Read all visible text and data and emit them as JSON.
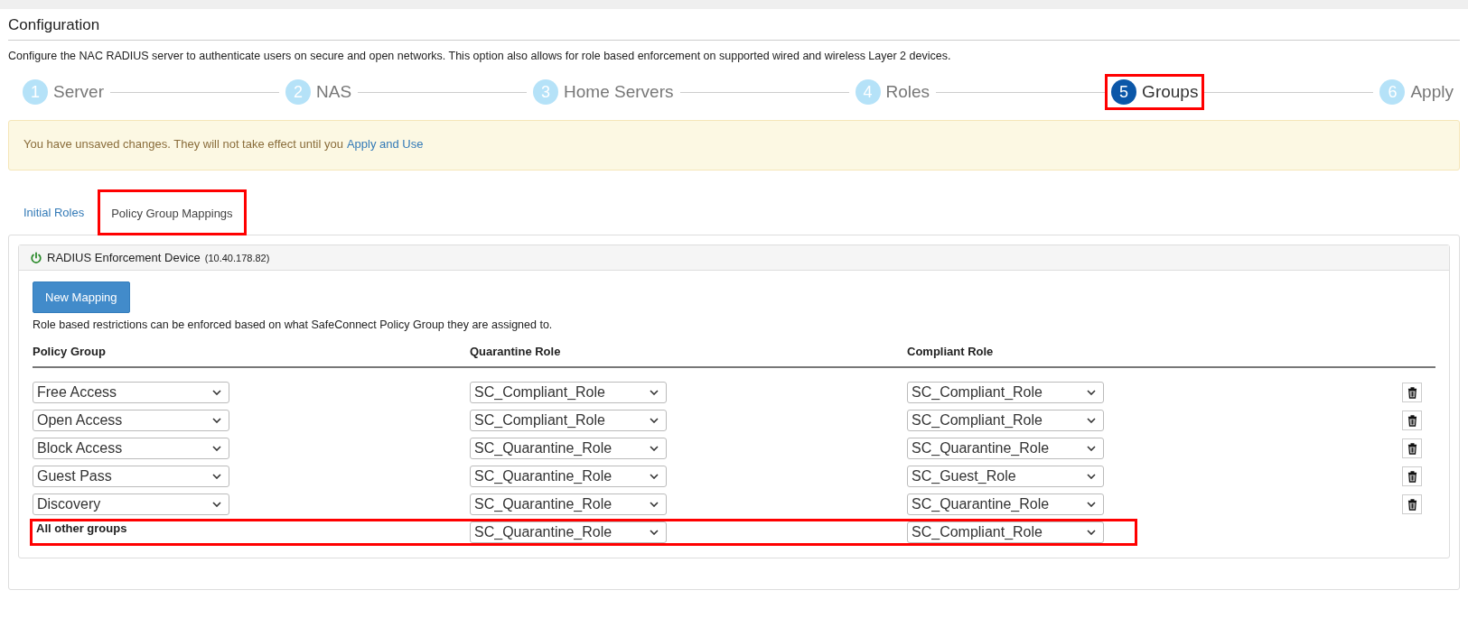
{
  "title": "Configuration",
  "description": "Configure the NAC RADIUS server to authenticate users on secure and open networks. This option also allows for role based enforcement on supported wired and wireless Layer 2 devices.",
  "steps": [
    {
      "number": "1",
      "label": "Server",
      "selected": false,
      "outlined": false
    },
    {
      "number": "2",
      "label": "NAS",
      "selected": false,
      "outlined": false
    },
    {
      "number": "3",
      "label": "Home Servers",
      "selected": false,
      "outlined": false
    },
    {
      "number": "4",
      "label": "Roles",
      "selected": false,
      "outlined": false
    },
    {
      "number": "5",
      "label": "Groups",
      "selected": true,
      "outlined": true
    },
    {
      "number": "6",
      "label": "Apply",
      "selected": false,
      "outlined": false
    }
  ],
  "alert": {
    "text": "You have unsaved changes. They will not take effect until you",
    "link": "Apply and Use"
  },
  "tabs": [
    {
      "label": "Initial Roles",
      "selected": false,
      "highlighted": false
    },
    {
      "label": "Policy Group Mappings",
      "selected": true,
      "highlighted": true
    }
  ],
  "device": {
    "name": "RADIUS Enforcement Device",
    "address": "(10.40.178.82)"
  },
  "new_mapping_button": "New Mapping",
  "help_text": "Role based restrictions can be enforced based on what SafeConnect Policy Group they are assigned to.",
  "columns": [
    "Policy Group",
    "Quarantine Role",
    "Compliant Role"
  ],
  "mappings": [
    {
      "policy_group": {
        "kind": "select",
        "value": "Free Access"
      },
      "quarantine_role": "SC_Compliant_Role",
      "compliant_role": "SC_Compliant_Role",
      "deletable": true,
      "highlighted": false
    },
    {
      "policy_group": {
        "kind": "select",
        "value": "Open Access"
      },
      "quarantine_role": "SC_Compliant_Role",
      "compliant_role": "SC_Compliant_Role",
      "deletable": true,
      "highlighted": false
    },
    {
      "policy_group": {
        "kind": "select",
        "value": "Block Access"
      },
      "quarantine_role": "SC_Quarantine_Role",
      "compliant_role": "SC_Quarantine_Role",
      "deletable": true,
      "highlighted": false
    },
    {
      "policy_group": {
        "kind": "select",
        "value": "Guest Pass"
      },
      "quarantine_role": "SC_Quarantine_Role",
      "compliant_role": "SC_Guest_Role",
      "deletable": true,
      "highlighted": false
    },
    {
      "policy_group": {
        "kind": "select",
        "value": "Discovery"
      },
      "quarantine_role": "SC_Quarantine_Role",
      "compliant_role": "SC_Quarantine_Role",
      "deletable": true,
      "highlighted": false
    },
    {
      "policy_group": {
        "kind": "label",
        "value": "All other groups"
      },
      "quarantine_role": "SC_Quarantine_Role",
      "compliant_role": "SC_Compliant_Role",
      "deletable": false,
      "highlighted": true
    }
  ]
}
